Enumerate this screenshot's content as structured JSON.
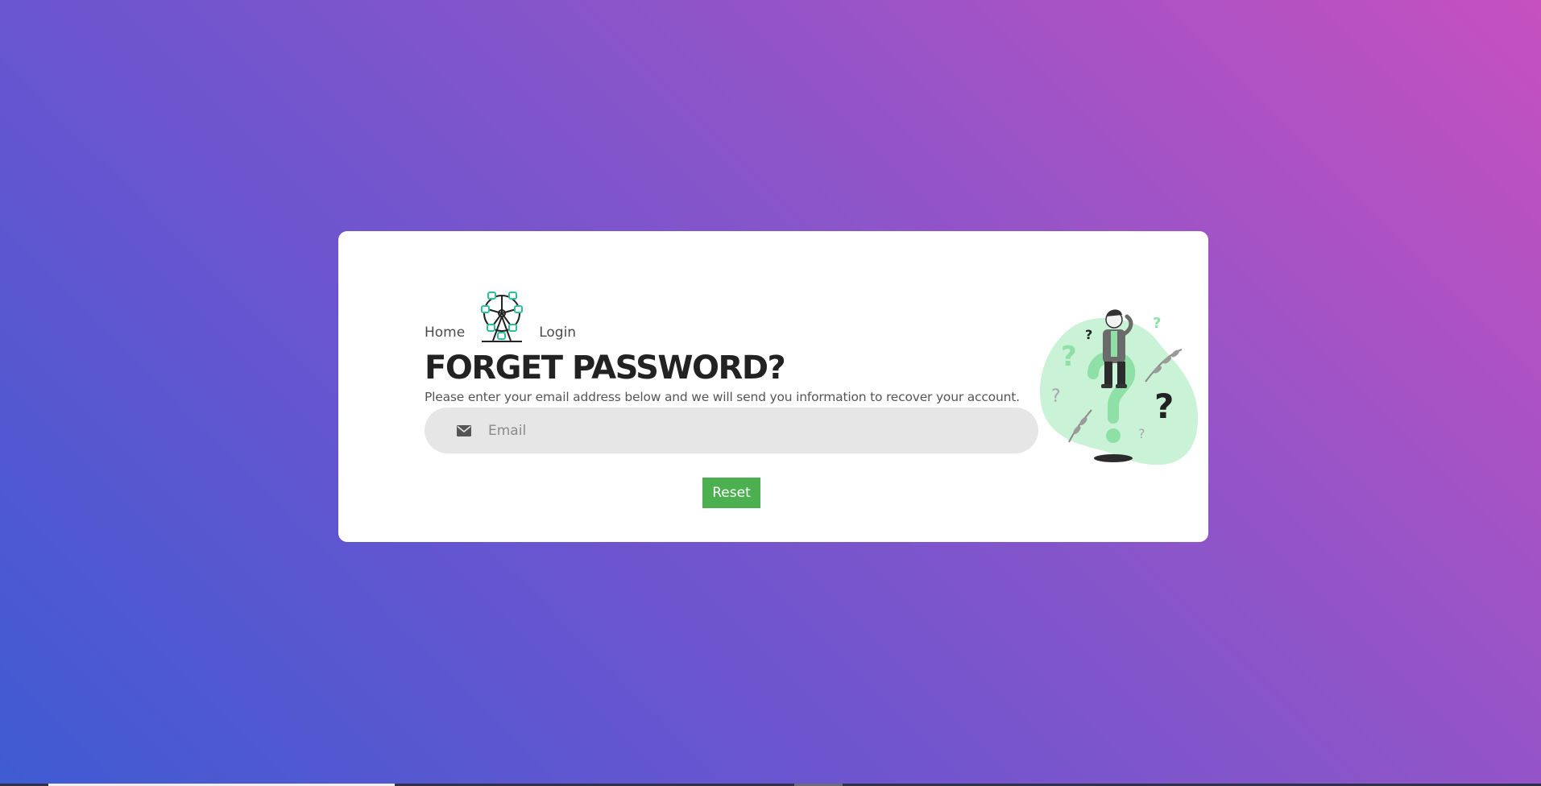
{
  "nav": {
    "home_label": "Home",
    "login_label": "Login",
    "logo_icon": "ferris-wheel-icon"
  },
  "page": {
    "title": "FORGET PASSWORD?",
    "subtitle": "Please enter your email address below and we will send you information to recover your account."
  },
  "form": {
    "email_icon": "envelope-icon",
    "email_placeholder": "Email",
    "email_value": "",
    "reset_label": "Reset"
  },
  "colors": {
    "accent_green": "#4caf50",
    "logo_teal": "#2bbf9b",
    "illustration_mint": "#c9f2d6"
  },
  "illustration": {
    "icon": "confused-person-question-marks-illustration"
  }
}
